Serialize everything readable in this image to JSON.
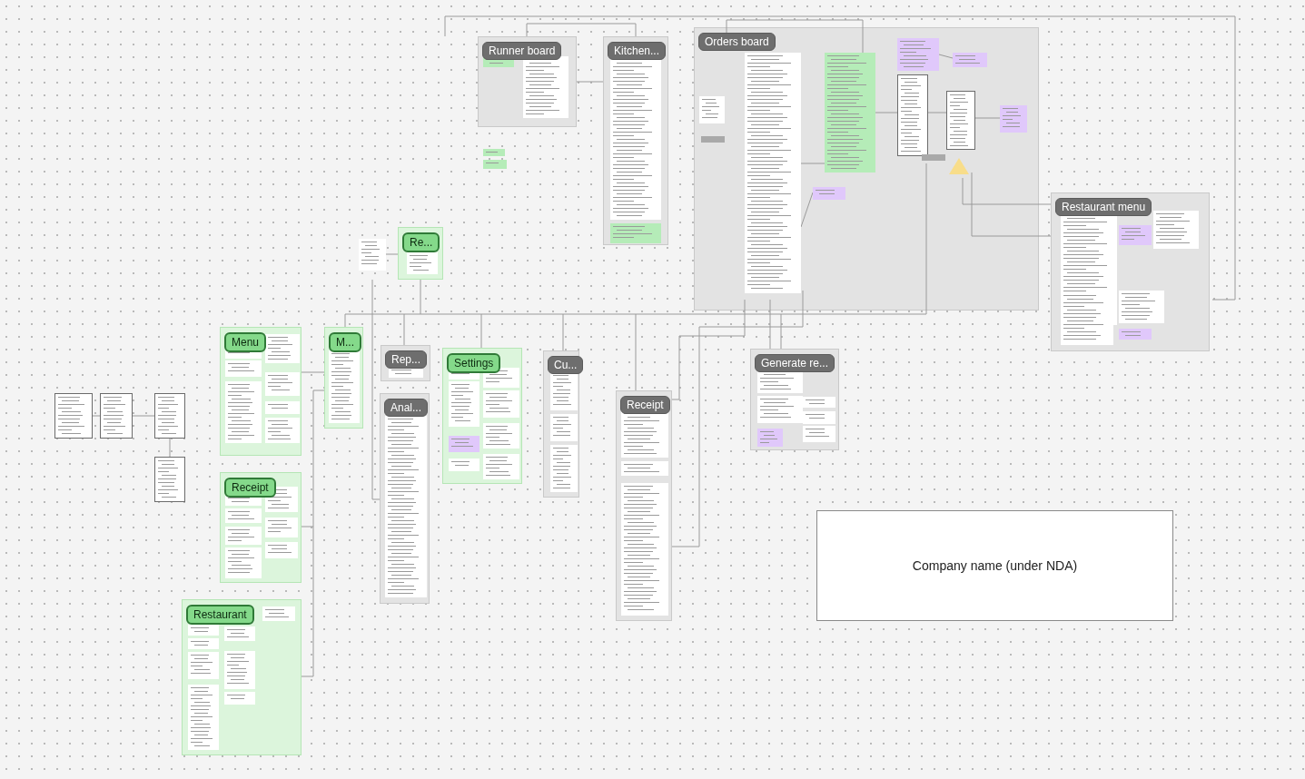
{
  "canvas": {
    "sections": [
      {
        "title": "Runner board",
        "kind": "grey"
      },
      {
        "title": "Kitchen...",
        "kind": "grey"
      },
      {
        "title": "Orders board",
        "kind": "grey"
      },
      {
        "title": "Restaurant menu",
        "kind": "grey"
      },
      {
        "title": "Re...",
        "kind": "green"
      },
      {
        "title": "Menu",
        "kind": "green"
      },
      {
        "title": "M...",
        "kind": "green"
      },
      {
        "title": "Rep...",
        "kind": "grey"
      },
      {
        "title": "Settings",
        "kind": "green"
      },
      {
        "title": "Cu...",
        "kind": "grey"
      },
      {
        "title": "Anal...",
        "kind": "grey"
      },
      {
        "title": "Receipt",
        "kind": "grey"
      },
      {
        "title": "Generate re...",
        "kind": "grey"
      },
      {
        "title": "Receipt",
        "kind": "green"
      },
      {
        "title": "Restaurant",
        "kind": "green"
      }
    ],
    "company_note": "Company name (under NDA)"
  }
}
